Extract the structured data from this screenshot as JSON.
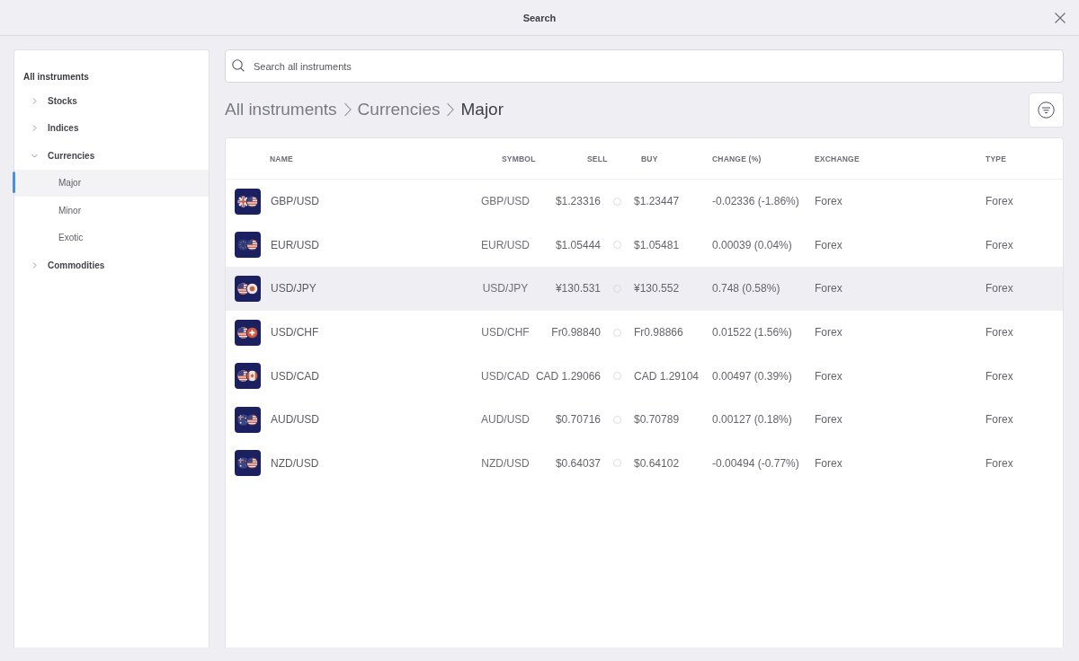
{
  "window": {
    "title": "Search"
  },
  "sidebar": {
    "title": "All instruments",
    "items": [
      {
        "label": "Stocks",
        "expanded": false,
        "selected": false
      },
      {
        "label": "Indices",
        "expanded": false,
        "selected": false
      },
      {
        "label": "Currencies",
        "expanded": true,
        "selected": false,
        "children": [
          {
            "label": "Major",
            "selected": true
          },
          {
            "label": "Minor",
            "selected": false
          },
          {
            "label": "Exotic",
            "selected": false
          }
        ]
      },
      {
        "label": "Commodities",
        "expanded": false,
        "selected": false
      }
    ]
  },
  "search": {
    "placeholder": "Search all instruments"
  },
  "breadcrumb": [
    "All instruments",
    "Currencies",
    "Major"
  ],
  "table": {
    "columns": [
      "NAME",
      "SYMBOL",
      "SELL",
      "BUY",
      "CHANGE (%)",
      "EXCHANGE",
      "TYPE"
    ],
    "rows": [
      {
        "kind": "gbpusd",
        "name": "GBP/USD",
        "symbol": "GBP/USD",
        "sell": "$1.23316",
        "buy": "$1.23447",
        "change": "-0.02336 (-1.86%)",
        "exchange": "Forex",
        "type": "Forex",
        "selected": false
      },
      {
        "kind": "eurusd",
        "name": "EUR/USD",
        "symbol": "EUR/USD",
        "sell": "$1.05444",
        "buy": "$1.05481",
        "change": "0.00039 (0.04%)",
        "exchange": "Forex",
        "type": "Forex",
        "selected": false
      },
      {
        "kind": "usdjpy",
        "name": "USD/JPY",
        "symbol": "USD/JPY",
        "sell": "¥130.531",
        "buy": "¥130.552",
        "change": "0.748 (0.58%)",
        "exchange": "Forex",
        "type": "Forex",
        "selected": true
      },
      {
        "kind": "usdchf",
        "name": "USD/CHF",
        "symbol": "USD/CHF",
        "sell": "Fr0.98840",
        "buy": "Fr0.98866",
        "change": "0.01522 (1.56%)",
        "exchange": "Forex",
        "type": "Forex",
        "selected": false
      },
      {
        "kind": "usdcad",
        "name": "USD/CAD",
        "symbol": "USD/CAD",
        "sell": "CAD 1.29066",
        "buy": "CAD 1.29104",
        "change": "0.00497 (0.39%)",
        "exchange": "Forex",
        "type": "Forex",
        "selected": false
      },
      {
        "kind": "audusd",
        "name": "AUD/USD",
        "symbol": "AUD/USD",
        "sell": "$0.70716",
        "buy": "$0.70789",
        "change": "0.00127 (0.18%)",
        "exchange": "Forex",
        "type": "Forex",
        "selected": false
      },
      {
        "kind": "nzdusd",
        "name": "NZD/USD",
        "symbol": "NZD/USD",
        "sell": "$0.64037",
        "buy": "$0.64102",
        "change": "-0.00494 (-0.77%)",
        "exchange": "Forex",
        "type": "Forex",
        "selected": false
      }
    ]
  }
}
